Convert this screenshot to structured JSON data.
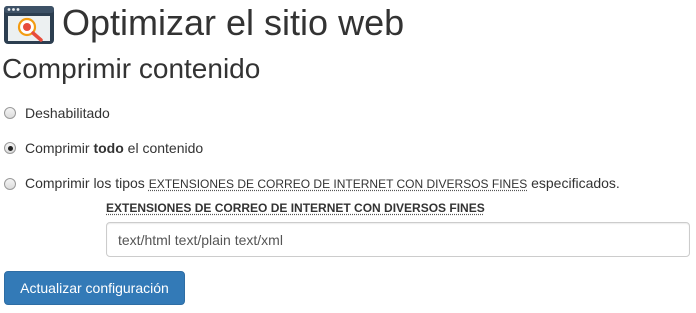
{
  "header": {
    "icon": "optimize-website-icon",
    "title": "Optimizar el sitio web"
  },
  "section": {
    "title": "Comprimir contenido"
  },
  "options": {
    "disabled": {
      "label": "Deshabilitado",
      "checked": false
    },
    "all": {
      "prefix": "Comprimir ",
      "emphasis": "todo",
      "suffix": " el contenido",
      "checked": true
    },
    "types": {
      "prefix": "Comprimir los tipos ",
      "abbr": "EXTENSIONES DE CORREO DE INTERNET CON DIVERSOS FINES",
      "suffix": " especificados.",
      "checked": false
    }
  },
  "mime_field": {
    "label": "EXTENSIONES DE CORREO DE INTERNET CON DIVERSOS FINES",
    "value": "text/html text/plain text/xml"
  },
  "buttons": {
    "update": "Actualizar configuración"
  },
  "colors": {
    "primary_button": "#337ab7",
    "icon_dark": "#2c3e50",
    "icon_accent": "#e74c3c"
  }
}
